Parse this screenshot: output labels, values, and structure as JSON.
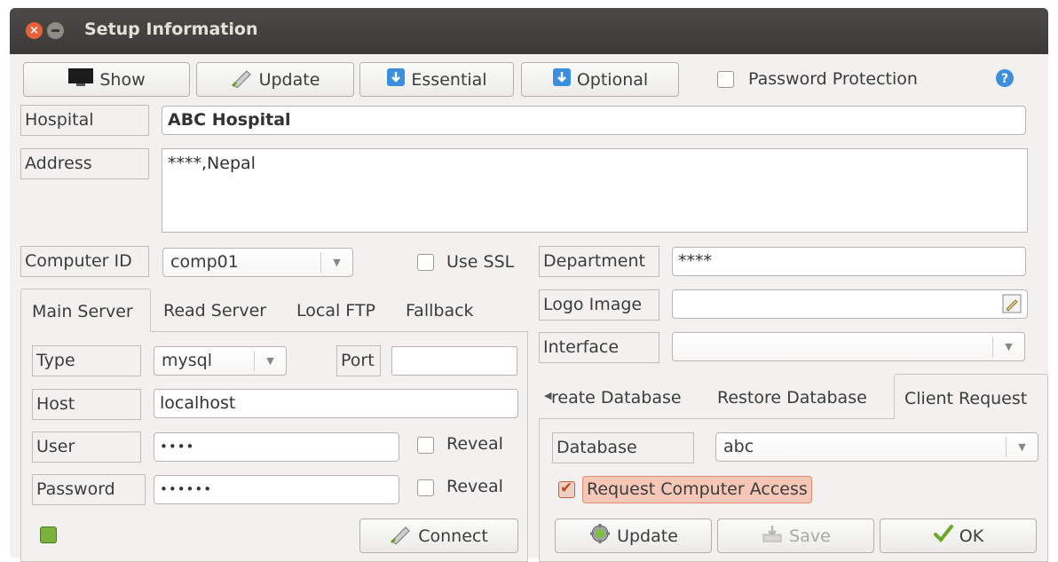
{
  "window": {
    "title": "Setup Information"
  },
  "toolbar": {
    "show_label": "Show",
    "update_label": "Update",
    "essential_label": "Essential",
    "optional_label": "Optional",
    "password_protection_label": "Password Protection"
  },
  "form": {
    "hospital_label": "Hospital",
    "hospital_value": "ABC Hospital",
    "address_label": "Address",
    "address_value": "****,Nepal",
    "computer_id_label": "Computer ID",
    "computer_id_value": "comp01",
    "use_ssl_label": "Use SSL",
    "department_label": "Department",
    "department_value": "****",
    "logo_image_label": "Logo Image",
    "logo_image_value": "",
    "interface_label": "Interface",
    "interface_value": ""
  },
  "server_tabs": {
    "tabs": [
      "Main Server",
      "Read Server",
      "Local FTP",
      "Fallback"
    ],
    "type_label": "Type",
    "type_value": "mysql",
    "port_label": "Port",
    "port_value": "",
    "host_label": "Host",
    "host_value": "localhost",
    "user_label": "User",
    "user_value": "••••",
    "password_label": "Password",
    "password_value": "••••••",
    "reveal_label": "Reveal",
    "connect_label": "Connect",
    "status_color": "#7bb23b"
  },
  "db_tabs": {
    "tabs": [
      "reate Database",
      "Restore Database",
      "Client Request"
    ],
    "database_label": "Database",
    "database_value": "abc",
    "request_access_label": "Request Computer Access",
    "update_label": "Update",
    "save_label": "Save",
    "ok_label": "OK"
  },
  "colors": {
    "titlebar": "#3b3a37",
    "accent": "#e9603a",
    "info_blue": "#3d8ee0",
    "ok_green": "#6aa827"
  }
}
